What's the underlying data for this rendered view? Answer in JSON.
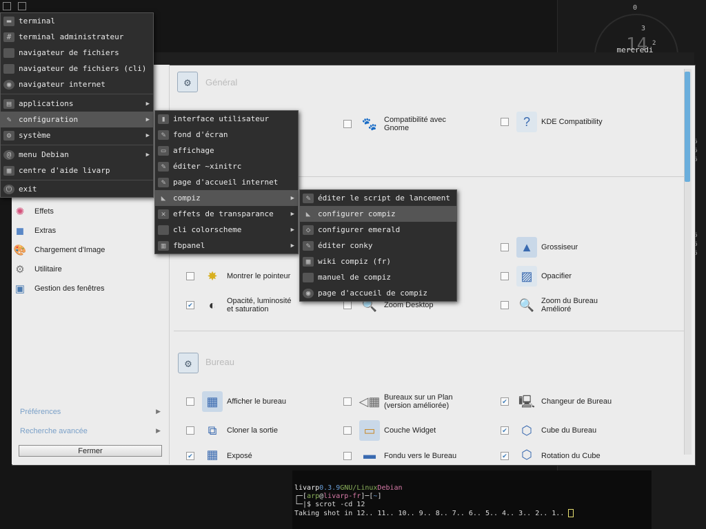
{
  "desktop": {
    "clock": {
      "n0": "0",
      "n3": "3",
      "n2": "2",
      "big": "14",
      "day": "mercredi"
    },
    "side_numbers": [
      "6",
      "6",
      "6",
      "6",
      "6",
      "6"
    ]
  },
  "main_menu": {
    "items": [
      {
        "label": "terminal",
        "icon": "terminal-icon"
      },
      {
        "label": "terminal administrateur",
        "icon": "root-terminal-icon"
      },
      {
        "label": "navigateur de fichiers",
        "icon": "folder-icon"
      },
      {
        "label": "navigateur de fichiers (cli)",
        "icon": "folder-icon"
      },
      {
        "label": "navigateur internet",
        "icon": "browser-icon"
      },
      {
        "label": "applications",
        "icon": "apps-icon",
        "sub": true
      },
      {
        "label": "configuration",
        "icon": "config-icon",
        "sub": true,
        "active": true
      },
      {
        "label": "système",
        "icon": "gear-icon",
        "sub": true
      },
      {
        "label": "menu Debian",
        "icon": "debian-icon",
        "sub": true
      },
      {
        "label": "centre d'aide livarp",
        "icon": "help-icon"
      },
      {
        "label": "exit",
        "icon": "power-icon"
      }
    ]
  },
  "config_menu": {
    "items": [
      {
        "label": "interface utilisateur"
      },
      {
        "label": "fond d'écran"
      },
      {
        "label": "affichage"
      },
      {
        "label": "éditer ~xinitrc"
      },
      {
        "label": "page d'accueil internet"
      },
      {
        "label": "compiz",
        "sub": true,
        "active": true
      },
      {
        "label": "effets de transparance",
        "sub": true
      },
      {
        "label": "cli colorscheme",
        "sub": true
      },
      {
        "label": "fbpanel",
        "sub": true
      }
    ]
  },
  "compiz_menu": {
    "items": [
      {
        "label": "éditer le script de lancement"
      },
      {
        "label": "configurer compiz",
        "active": true
      },
      {
        "label": "configurer emerald"
      },
      {
        "label": "éditer conky"
      },
      {
        "label": "wiki compiz (fr)"
      },
      {
        "label": "manuel de compiz"
      },
      {
        "label": "page d'accueil de compiz"
      }
    ]
  },
  "ccsm": {
    "categories": [
      "Effets",
      "Extras",
      "Chargement d'Image",
      "Utilitaire",
      "Gestion des fenêtres"
    ],
    "preferences": "Préférences",
    "advanced_search": "Recherche avancée",
    "close": "Fermer",
    "section_general": "Général",
    "section_bureau": "Bureau",
    "general_plugins": [
      {
        "label": "Compatibilité avec",
        "label2": "Gnome",
        "checked": false
      },
      {
        "label": "KDE Compatibility",
        "label2": "",
        "checked": false
      }
    ],
    "access_plugins": [
      {
        "label": "Grossiseur",
        "label2": "",
        "checked": false
      },
      {
        "label": "Montrer le pointeur",
        "label2": "",
        "checked": false
      },
      {
        "label": "Opacifier",
        "label2": "",
        "checked": false
      },
      {
        "label": "Opacité, luminosité",
        "label2": "et saturation",
        "checked": true
      },
      {
        "label": "Zoom Desktop",
        "label2": "",
        "checked": false
      },
      {
        "label": "Zoom du Bureau",
        "label2": "Amélioré",
        "checked": false
      }
    ],
    "bureau_plugins": [
      {
        "label": "Afficher le bureau",
        "label2": "",
        "checked": false
      },
      {
        "label": "Bureaux sur un Plan",
        "label2": "(version améliorée)",
        "checked": false
      },
      {
        "label": "Changeur de Bureau",
        "label2": "",
        "checked": true
      },
      {
        "label": "Cloner la sortie",
        "label2": "",
        "checked": false
      },
      {
        "label": "Couche Widget",
        "label2": "",
        "checked": false
      },
      {
        "label": "Cube du Bureau",
        "label2": "",
        "checked": true
      },
      {
        "label": "Exposé",
        "label2": "",
        "checked": true
      },
      {
        "label": "Fondu vers le Bureau",
        "label2": "",
        "checked": false
      },
      {
        "label": "Rotation du Cube",
        "label2": "",
        "checked": true
      }
    ]
  },
  "terminal": {
    "l1a": "livarp",
    "l1b": "0.3.9",
    "l1c": "GNU/Linux",
    "l1d": "Debian",
    "l2a": "┌─[",
    "l2b": "arp",
    "l2c": "@",
    "l2d": "livarp-fr",
    "l2e": "]─[",
    "l2f": "~",
    "l2g": "]",
    "l3": "└─|$ scrot -cd 12",
    "l4": "Taking shot in 12.. 11.. 10.. 9.. 8.. 7.. 6.. 5.. 4.. 3.. 2.. 1.. ",
    "colors": {
      "green": "#8ab05a",
      "blue": "#6a9fd8",
      "pink": "#d87aa8"
    }
  }
}
